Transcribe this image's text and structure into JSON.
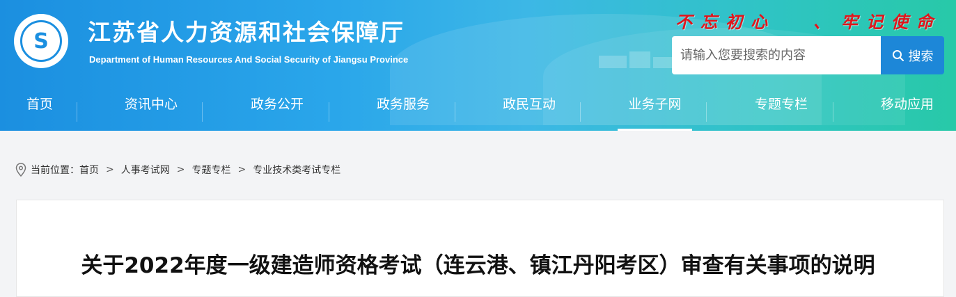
{
  "header": {
    "site_title": "江苏省人力资源和社会保障厅",
    "site_subtitle": "Department of Human Resources And Social Security of Jiangsu Province",
    "logo_char": "S",
    "slogan_left": "不忘初心",
    "slogan_sep": "、",
    "slogan_right": "牢记使命",
    "search": {
      "placeholder": "请输入您要搜索的内容",
      "button_label": "搜索"
    }
  },
  "nav": {
    "items": [
      {
        "label": "首页"
      },
      {
        "label": "资讯中心"
      },
      {
        "label": "政务公开"
      },
      {
        "label": "政务服务"
      },
      {
        "label": "政民互动"
      },
      {
        "label": "业务子网"
      },
      {
        "label": "专题专栏"
      },
      {
        "label": "移动应用"
      }
    ],
    "active_label": "业务子网"
  },
  "breadcrumb": {
    "prefix": "当前位置：",
    "items": [
      "首页",
      "人事考试网",
      "专题专栏",
      "专业技术类考试专栏"
    ],
    "separator": ">"
  },
  "article": {
    "title": "关于2022年度一级建造师资格考试（连云港、镇江丹阳考区）审查有关事项的说明"
  },
  "colors": {
    "header_gradient_start": "#1b8fe0",
    "header_gradient_end": "#28c9a8",
    "slogan": "#e1141b",
    "search_button": "#1d87d8"
  }
}
